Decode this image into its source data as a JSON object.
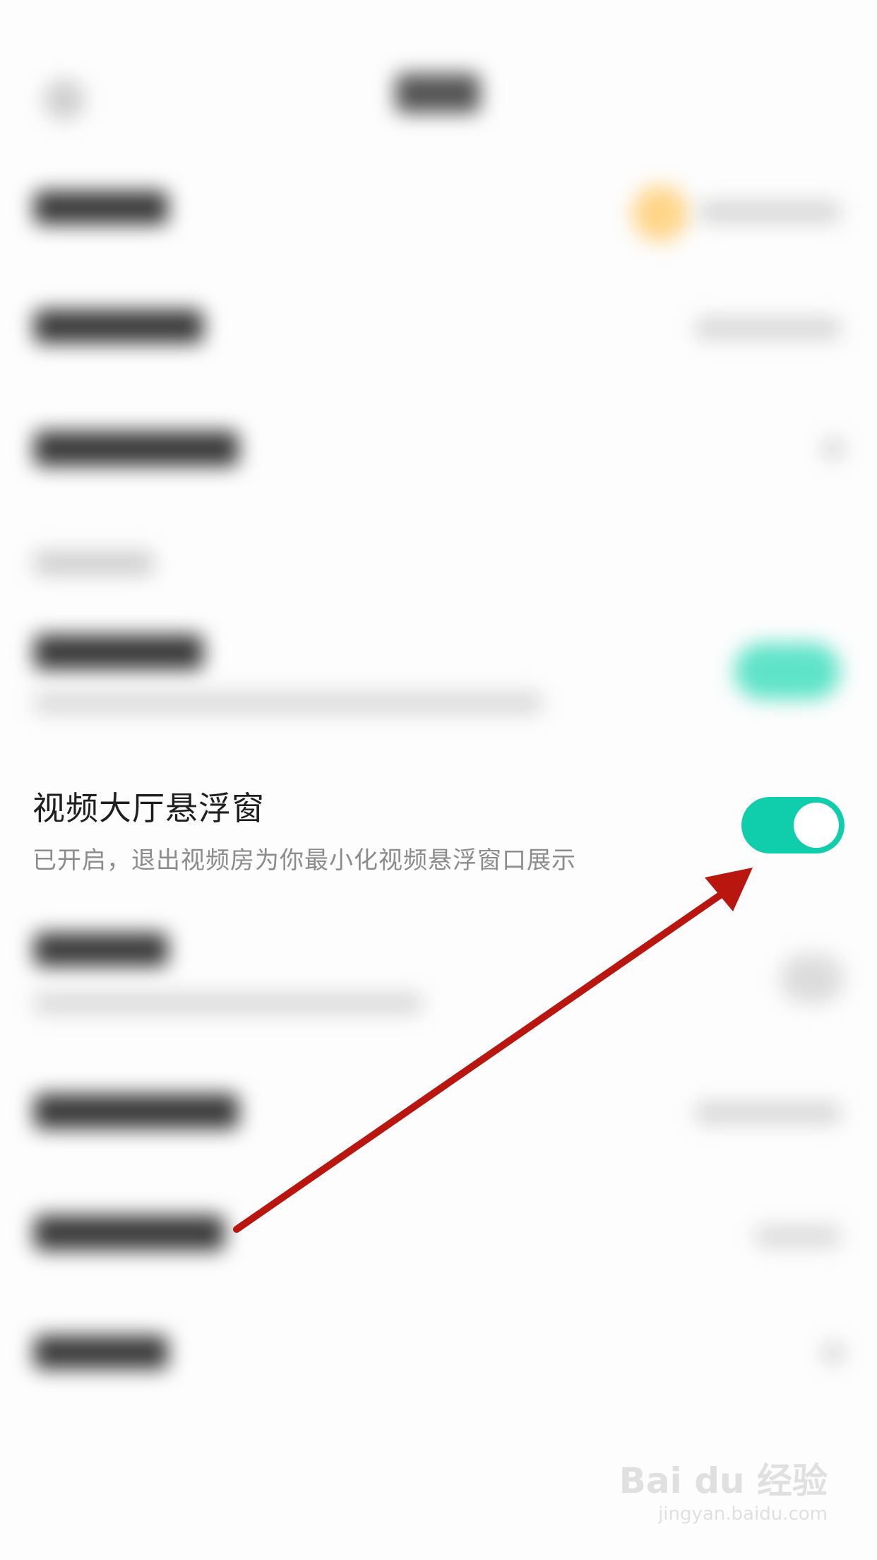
{
  "setting": {
    "title": "视频大厅悬浮窗",
    "subtitle": "已开启，退出视频房为你最小化视频悬浮窗口展示",
    "enabled": true
  },
  "colors": {
    "toggle_on": "#10cdab",
    "arrow": "#b8160f"
  },
  "watermark": {
    "logo": "Bai du 经验",
    "url": "jingyan.baidu.com"
  }
}
